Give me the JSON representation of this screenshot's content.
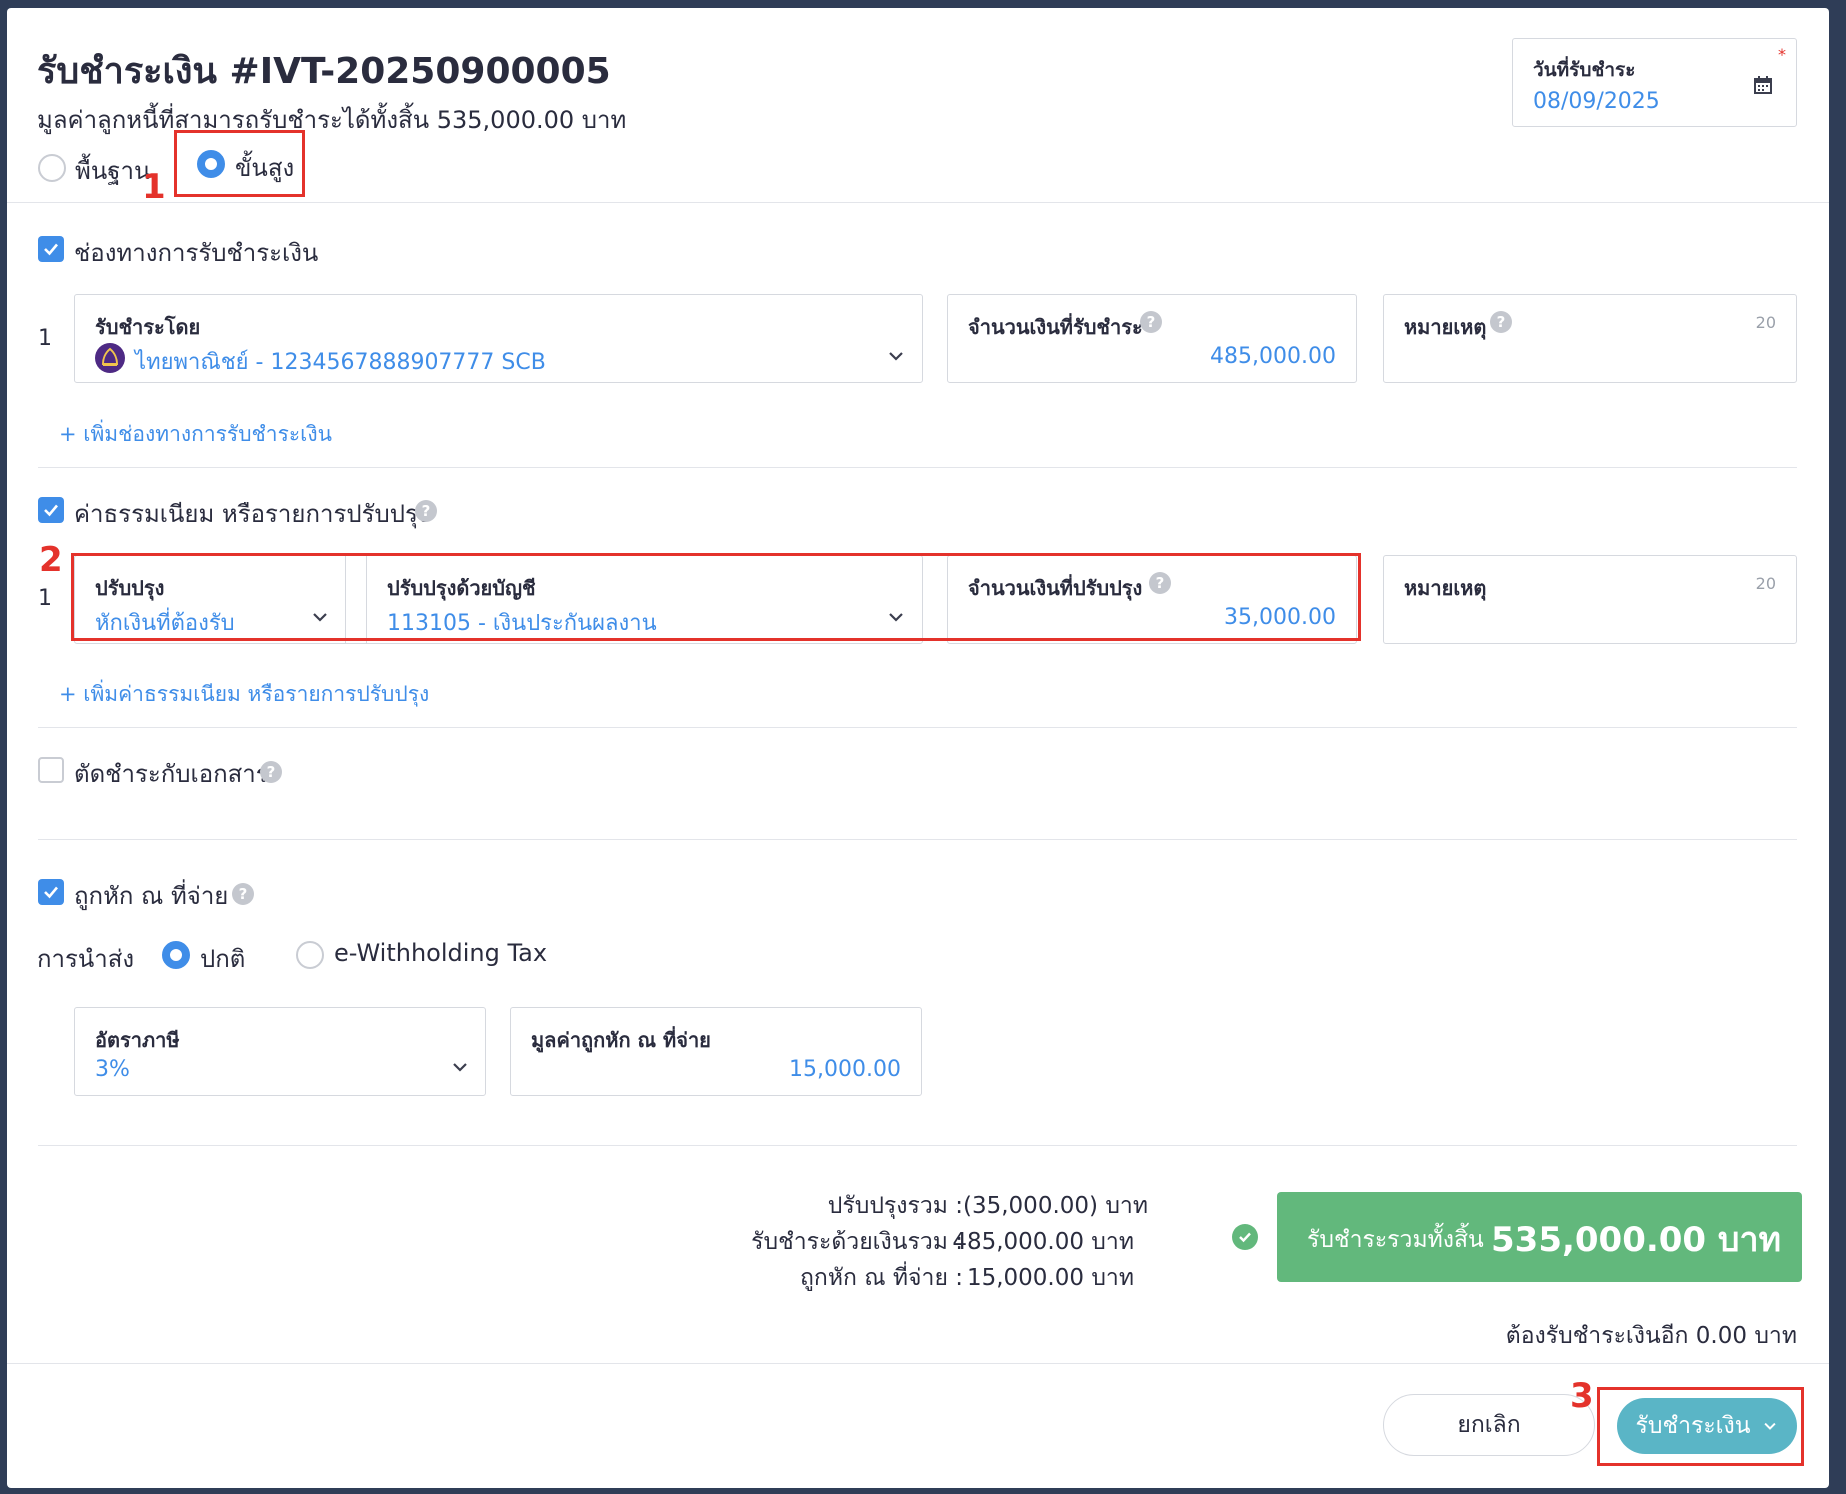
{
  "header": {
    "title": "รับชำระเงิน #IVT-20250900005",
    "subtitle": "มูลค่าลูกหนี้ที่สามารถรับชำระได้ทั้งสิ้น 535,000.00 บาท",
    "mode_options": [
      "พื้นฐาน",
      "ขั้นสูง"
    ],
    "mode_selected": "ขั้นสูง",
    "date_field": {
      "label": "วันที่รับชำระ",
      "value": "08/09/2025",
      "required_mark": "*"
    }
  },
  "annotations": {
    "n1": "1",
    "n2": "2",
    "n3": "3"
  },
  "payment_channel": {
    "section_label": "ช่องทางการรับชำระเงิน",
    "checked": true,
    "rows": [
      {
        "index": "1",
        "paid_by_label": "รับชำระโดย",
        "paid_by_value": "ไทยพาณิชย์ - 1234567888907777 SCB",
        "amount_label": "จำนวนเงินที่รับชำระ",
        "amount_value": "485,000.00",
        "note_label": "หมายเหตุ",
        "note_counter": "20"
      }
    ],
    "add_link": "+ เพิ่มช่องทางการรับชำระเงิน"
  },
  "fees": {
    "section_label": "ค่าธรรมเนียม หรือรายการปรับปรุง",
    "checked": true,
    "rows": [
      {
        "index": "1",
        "adjust_label": "ปรับปรุง",
        "adjust_value": "หักเงินที่ต้องรับ",
        "account_label": "ปรับปรุงด้วยบัญชี",
        "account_value": "113105 - เงินประกันผลงาน",
        "amount_label": "จำนวนเงินที่ปรับปรุง",
        "amount_value": "35,000.00",
        "note_label": "หมายเหตุ",
        "note_counter": "20"
      }
    ],
    "add_link": "+ เพิ่มค่าธรรมเนียม หรือรายการปรับปรุง"
  },
  "offset": {
    "section_label": "ตัดชำระกับเอกสาร",
    "checked": false
  },
  "withholding": {
    "section_label": "ถูกหัก ณ ที่จ่าย",
    "checked": true,
    "submit_label": "การนำส่ง",
    "submit_options": [
      "ปกติ",
      "e-Withholding Tax"
    ],
    "submit_selected": "ปกติ",
    "rate_label": "อัตราภาษี",
    "rate_value": "3%",
    "amount_label": "มูลค่าถูกหัก ณ ที่จ่าย",
    "amount_value": "15,000.00"
  },
  "summary": {
    "adjust_label": "ปรับปรุงรวม :",
    "adjust_value": "(35,000.00) บาท",
    "paid_label": "รับชำระด้วยเงินรวม :",
    "paid_value": "485,000.00 บาท",
    "wht_label": "ถูกหัก ณ ที่จ่าย :",
    "wht_value": "15,000.00 บาท",
    "total_label": "รับชำระรวมทั้งสิ้น",
    "total_value": "535,000.00 บาท",
    "remaining": "ต้องรับชำระเงินอีก 0.00 บาท"
  },
  "footer": {
    "cancel_label": "ยกเลิก",
    "submit_label": "รับชำระเงิน"
  },
  "colors": {
    "accent": "#3f8de8",
    "success": "#62b87c",
    "primary_button": "#5ab5c6",
    "annotation": "#e4322b",
    "bank_logo": "#4e2a84"
  }
}
